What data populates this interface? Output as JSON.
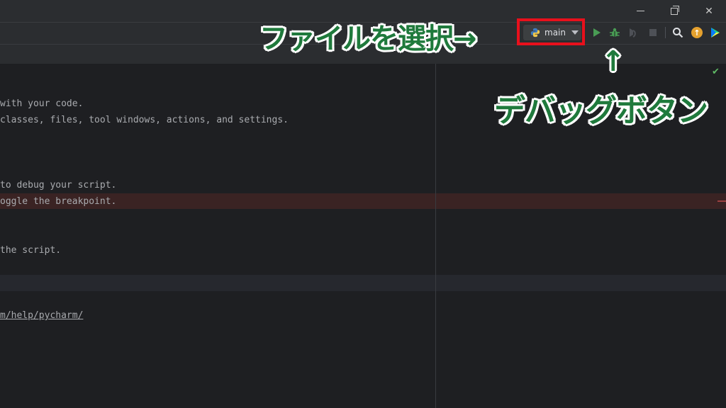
{
  "window": {
    "minimize": "minimize",
    "maximize": "restore",
    "close": "✕"
  },
  "toolbar": {
    "run_config": "main",
    "icons": [
      "python-icon",
      "run-icon",
      "debug-icon",
      "coverage-icon",
      "stop-icon",
      "search-icon",
      "update-icon",
      "plugin-icon"
    ],
    "update_glyph": "↑"
  },
  "editor": {
    "lines": [
      "with your code.",
      "classes, files, tool windows, actions, and settings.",
      "to debug your script.",
      "oggle the breakpoint.",
      "the script.",
      "m/help/pycharm/"
    ],
    "status_check": "✔"
  },
  "annotations": {
    "file_select": "ファイルを選択→",
    "debug_button": "デバッグボタン",
    "arrow": "↑"
  },
  "colors": {
    "annotation_green": "#1f7a3c",
    "highlight_box": "#e8101c",
    "run_green": "#499c54"
  }
}
